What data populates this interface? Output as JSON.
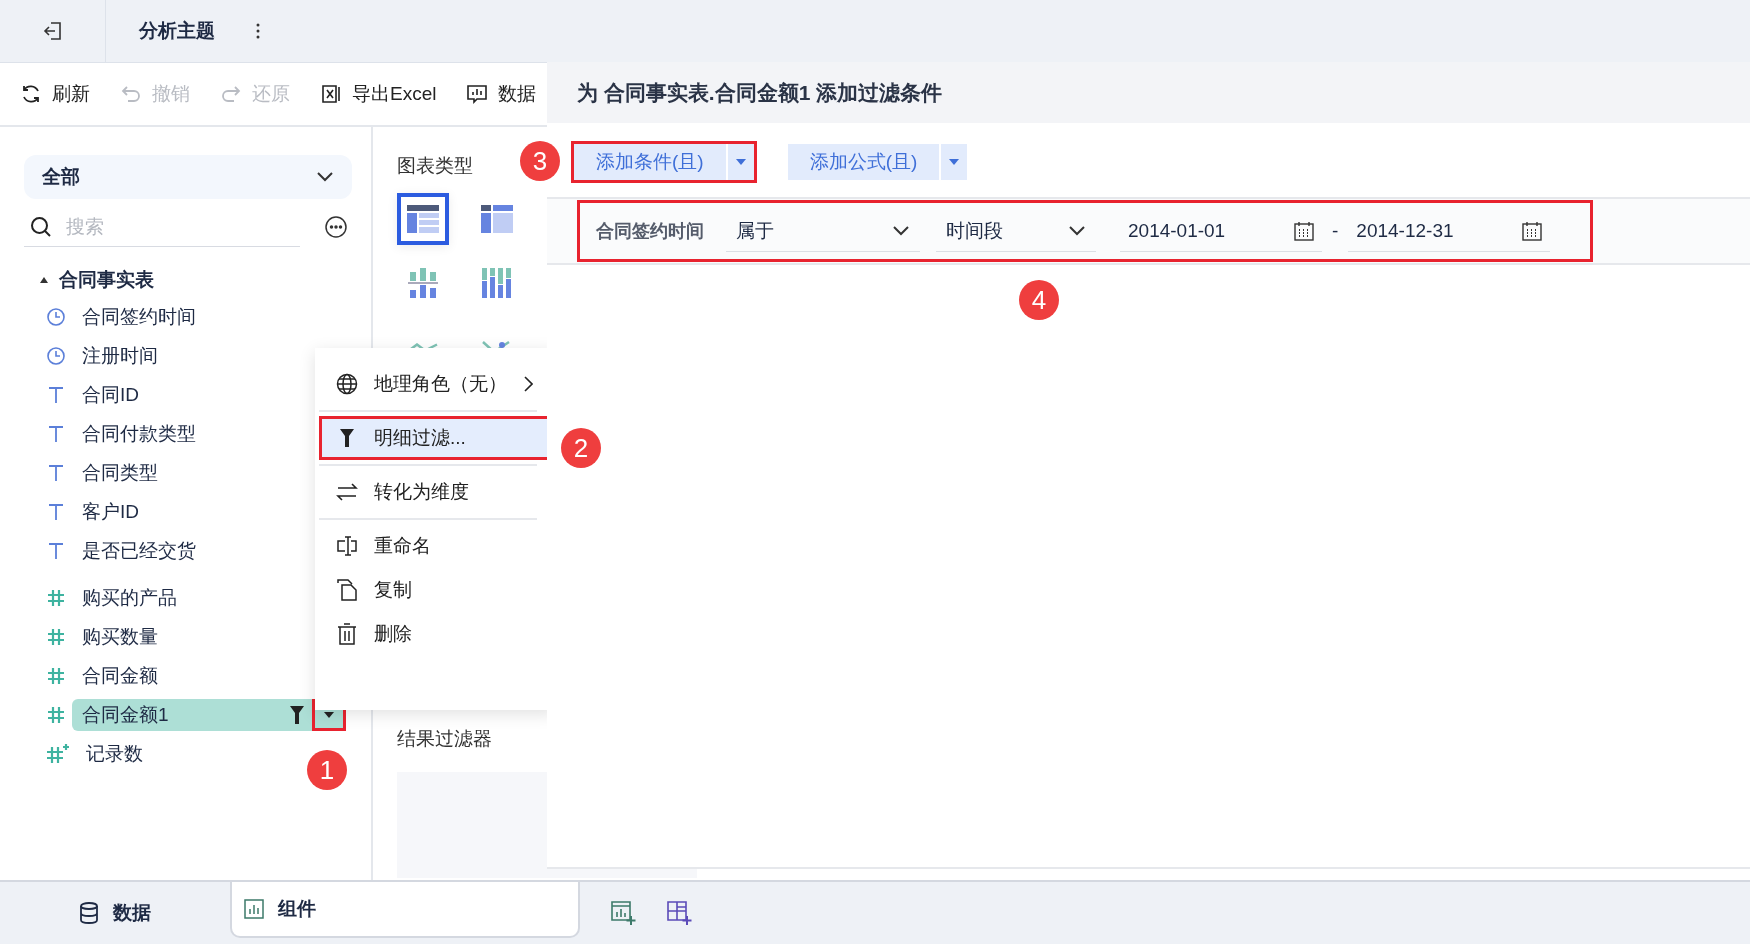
{
  "topbar": {
    "title": "分析主题"
  },
  "toolbar": [
    {
      "label": "刷新",
      "kind": "refresh",
      "disabled": false
    },
    {
      "label": "撤销",
      "kind": "undo",
      "disabled": true
    },
    {
      "label": "还原",
      "kind": "redo",
      "disabled": true
    },
    {
      "label": "导出Excel",
      "kind": "excel",
      "disabled": false
    },
    {
      "label": "数据",
      "kind": "data",
      "disabled": false
    }
  ],
  "left_panel": {
    "scope": "全部",
    "search": {
      "placeholder": "搜索"
    },
    "table": {
      "name": "合同事实表",
      "expanded": true,
      "field_menu_button": {
        "highlighted": true
      },
      "fields": [
        {
          "name": "合同签约时间",
          "kind": "date",
          "selected": false,
          "filtered": false
        },
        {
          "name": "注册时间",
          "kind": "date",
          "selected": false,
          "filtered": false
        },
        {
          "name": "合同ID",
          "kind": "text",
          "selected": false,
          "filtered": false
        },
        {
          "name": "合同付款类型",
          "kind": "text",
          "selected": false,
          "filtered": false
        },
        {
          "name": "合同类型",
          "kind": "text",
          "selected": false,
          "filtered": false
        },
        {
          "name": "客户ID",
          "kind": "text",
          "selected": false,
          "filtered": false
        },
        {
          "name": "是否已经交货",
          "kind": "text",
          "selected": false,
          "filtered": false
        },
        {
          "name": "购买的产品",
          "kind": "number",
          "selected": false,
          "filtered": false
        },
        {
          "name": "购买数量",
          "kind": "number",
          "selected": false,
          "filtered": false
        },
        {
          "name": "合同金额",
          "kind": "number",
          "selected": false,
          "filtered": false
        },
        {
          "name": "合同金额1",
          "kind": "number",
          "selected": true,
          "filtered": true
        },
        {
          "name": "记录数",
          "kind": "count",
          "selected": false,
          "filtered": false
        }
      ]
    }
  },
  "middle_panel": {
    "chart_type_label": "图表类型",
    "chart_types": [
      {
        "kind": "table",
        "selected": true
      },
      {
        "kind": "crosstable",
        "selected": false
      },
      {
        "kind": "grouped-bar",
        "selected": false
      },
      {
        "kind": "stacked-bar",
        "selected": false
      },
      {
        "kind": "line",
        "selected": false
      },
      {
        "kind": "scatter",
        "selected": false
      }
    ],
    "result_filter_label": "结果过滤器"
  },
  "context_menu": {
    "sections": [
      [
        {
          "label": "地理角色（无）",
          "kind": "globe",
          "submenu": true,
          "selected": false,
          "highlighted": false
        }
      ],
      [
        {
          "label": "明细过滤...",
          "kind": "filter",
          "submenu": false,
          "selected": true,
          "highlighted": true
        }
      ],
      [
        {
          "label": "转化为维度",
          "kind": "swap",
          "submenu": false,
          "selected": false,
          "highlighted": false
        }
      ],
      [
        {
          "label": "重命名",
          "kind": "rename",
          "submenu": false,
          "selected": false,
          "highlighted": false
        },
        {
          "label": "复制",
          "kind": "copy",
          "submenu": false,
          "selected": false,
          "highlighted": false
        },
        {
          "label": "删除",
          "kind": "delete",
          "submenu": false,
          "selected": false,
          "highlighted": false
        }
      ]
    ]
  },
  "dialog": {
    "title": "为 合同事实表.合同金额1 添加过滤条件",
    "buttons": [
      {
        "label": "添加条件(且)",
        "highlighted": true
      },
      {
        "label": "添加公式(且)",
        "highlighted": false
      }
    ],
    "condition": {
      "highlighted": true,
      "field": "合同签约时间",
      "operator": "属于",
      "mode": "时间段",
      "start": "2014-01-01",
      "separator": "-",
      "end": "2014-12-31"
    }
  },
  "bottom_tabs": [
    {
      "label": "数据",
      "kind": "database",
      "selected": false
    },
    {
      "label": "组件",
      "kind": "chart",
      "selected": true
    }
  ],
  "annotations": [
    "1",
    "2",
    "3",
    "4"
  ]
}
